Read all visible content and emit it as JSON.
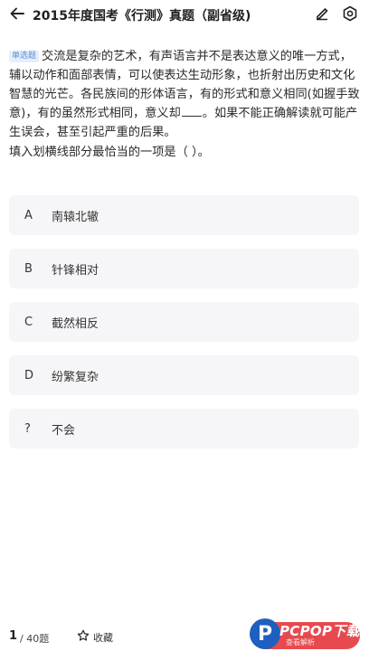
{
  "header": {
    "title": "2015年度国考《行测》真题（副省级)",
    "back_icon": "arrow-left-icon",
    "edit_icon": "pencil-icon",
    "settings_icon": "gear-icon"
  },
  "question": {
    "tag": "单选题",
    "text_before": "交流是复杂的艺术，有声语言并不是表达意义的唯一方式，辅以动作和面部表情，可以使表达生动形象，也折射出历史和文化智慧的光芒。各民族间的形体语言，有的形式和意义相同(如握手致意)，有的虽然形式相同，意义却",
    "text_after": "。如果不能正确解读就可能产生误会，甚至引起严重的后果。",
    "prompt": "填入划横线部分最恰当的一项是（   ）。"
  },
  "options": [
    {
      "letter": "A",
      "text": "南辕北辙"
    },
    {
      "letter": "B",
      "text": "针锋相对"
    },
    {
      "letter": "C",
      "text": "截然相反"
    },
    {
      "letter": "D",
      "text": "纷繁复杂"
    },
    {
      "letter": "?",
      "text": "不会"
    }
  ],
  "footer": {
    "page_current": "1",
    "page_total": "/ 40题",
    "favorite_label": "收藏",
    "favorite_icon": "star-outline-icon"
  },
  "watermark": {
    "logo_letter": "P",
    "brand": "PCPOP下载",
    "sub": "查看解析"
  },
  "colors": {
    "tag_text": "#5a8fd6",
    "tag_bg": "#e6effb",
    "option_bg": "#f6f6f8",
    "watermark_red": "#e64a4f",
    "watermark_blue": "#1e5fbf"
  }
}
